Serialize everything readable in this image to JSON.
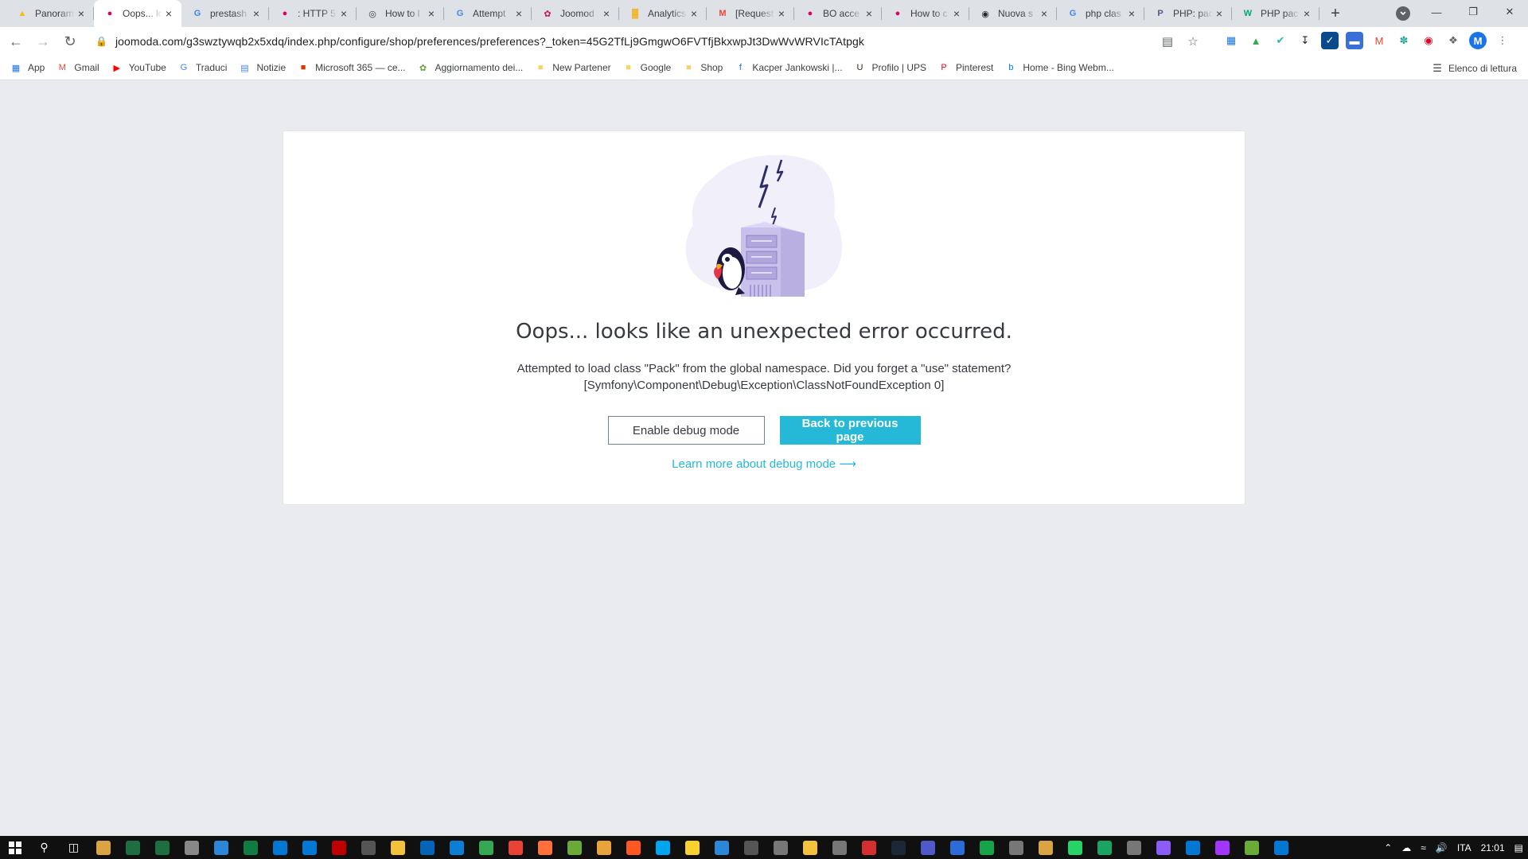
{
  "browser": {
    "tabs": [
      {
        "title": "Panoram",
        "icon": "google-ads-icon",
        "color": "#fbbc04"
      },
      {
        "title": "Oops... lo",
        "icon": "prestashop-icon",
        "color": "#df0067",
        "active": true
      },
      {
        "title": "prestash",
        "icon": "google-icon",
        "color": "#4285f4"
      },
      {
        "title": ": HTTP 5",
        "icon": "prestashop-icon",
        "color": "#df0067"
      },
      {
        "title": "How to l",
        "icon": "globe-icon",
        "color": "#3c4043"
      },
      {
        "title": "Attempt",
        "icon": "google-icon",
        "color": "#4285f4"
      },
      {
        "title": "Joomod",
        "icon": "joomoda-icon",
        "color": "#c2185b"
      },
      {
        "title": "Analytics",
        "icon": "analytics-icon",
        "color": "#f9ab00"
      },
      {
        "title": "[Request",
        "icon": "gmail-icon",
        "color": "#ea4335"
      },
      {
        "title": "BO acce",
        "icon": "prestashop-icon",
        "color": "#df0067"
      },
      {
        "title": "How to c",
        "icon": "prestashop-icon",
        "color": "#df0067"
      },
      {
        "title": "Nuova s",
        "icon": "github-icon",
        "color": "#24292e"
      },
      {
        "title": "php clas",
        "icon": "google-icon",
        "color": "#4285f4"
      },
      {
        "title": "PHP: pac",
        "icon": "php-icon",
        "color": "#4f5b93"
      },
      {
        "title": "PHP pac",
        "icon": "w3schools-icon",
        "color": "#04aa6d"
      }
    ],
    "url": "joomoda.com/g3swztywqb2x5xdq/index.php/configure/shop/preferences/preferences?_token=45G2TfLj9GmgwO6FVTfjBkxwpJt3DwWvWRVIcTAtpgk",
    "profile_initial": "M",
    "bookmarks": [
      {
        "label": "App",
        "icon": "apps-grid-icon",
        "color": "#1a73e8"
      },
      {
        "label": "Gmail",
        "icon": "gmail-icon",
        "color": "#ea4335"
      },
      {
        "label": "YouTube",
        "icon": "youtube-icon",
        "color": "#ff0000"
      },
      {
        "label": "Traduci",
        "icon": "translate-icon",
        "color": "#4285f4"
      },
      {
        "label": "Notizie",
        "icon": "news-icon",
        "color": "#4285f4"
      },
      {
        "label": "Microsoft 365 — ce...",
        "icon": "office-icon",
        "color": "#d83b01"
      },
      {
        "label": "Aggiornamento dei...",
        "icon": "leaf-icon",
        "color": "#689f38"
      },
      {
        "label": "New Partener",
        "icon": "folder-icon",
        "color": "#f6d36b"
      },
      {
        "label": "Google",
        "icon": "folder-icon",
        "color": "#f6d36b"
      },
      {
        "label": "Shop",
        "icon": "folder-icon",
        "color": "#f6d36b"
      },
      {
        "label": "Kacper Jankowski |...",
        "icon": "facebook-icon",
        "color": "#1877f2"
      },
      {
        "label": "Profilo | UPS",
        "icon": "ups-icon",
        "color": "#351c15"
      },
      {
        "label": "Pinterest",
        "icon": "pinterest-icon",
        "color": "#e60023"
      },
      {
        "label": "Home - Bing Webm...",
        "icon": "bing-icon",
        "color": "#0078d4"
      }
    ],
    "reading_list": "Elenco di lettura"
  },
  "error_page": {
    "title": "Oops... looks like an unexpected error occurred.",
    "message_line1": "Attempted to load class \"Pack\" from the global namespace. Did you forget a \"use\" statement?",
    "message_line2": "[Symfony\\Component\\Debug\\Exception\\ClassNotFoundException 0]",
    "enable_debug_label": "Enable debug mode",
    "back_label": "Back to previous page",
    "learn_more_label": "Learn more about debug mode",
    "accent_color": "#25b9d7"
  },
  "taskbar": {
    "language": "ITA",
    "time": "21:01"
  }
}
